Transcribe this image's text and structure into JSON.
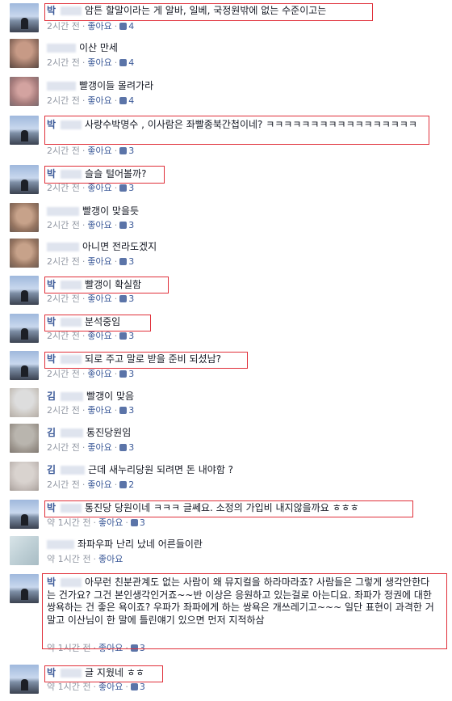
{
  "ui": {
    "like_label": "좋아요",
    "sep": "·"
  },
  "comments": [
    {
      "name": "박",
      "text": "암튼 할말이라는 게 알바, 일베, 국정원밖에 없는 수준이고는",
      "time": "2시간 전",
      "likes": "4"
    },
    {
      "name": "",
      "text": "이산 만세",
      "time": "2시간 전",
      "likes": "4"
    },
    {
      "name": "",
      "text": "빨갱이들 몰려가라",
      "time": "2시간 전",
      "likes": "4"
    },
    {
      "name": "박",
      "text": "사랑수박명수 , 이사람은 좌빨종북간첩이네? ㅋㅋㅋㅋㅋㅋㅋㅋㅋㅋㅋㅋㅋㅋㅋㅋㅋ",
      "time": "2시간 전",
      "likes": "3"
    },
    {
      "name": "박",
      "text": "슬슬 털어볼까?",
      "time": "2시간 전",
      "likes": "3"
    },
    {
      "name": "",
      "text": "빨갱이 맞을듯",
      "time": "2시간 전",
      "likes": "3"
    },
    {
      "name": "",
      "text": "아니면 전라도겠지",
      "time": "2시간 전",
      "likes": "3"
    },
    {
      "name": "박",
      "text": "빨갱이 확실함",
      "time": "2시간 전",
      "likes": "3"
    },
    {
      "name": "박",
      "text": "분석중임",
      "time": "2시간 전",
      "likes": "3"
    },
    {
      "name": "박",
      "text": "되로 주고 말로 받을 준비 되셨남?",
      "time": "2시간 전",
      "likes": "3"
    },
    {
      "name": "김",
      "text": "빨갱이 맞음",
      "time": "2시간 전",
      "likes": "3"
    },
    {
      "name": "김",
      "text": "통진당원임",
      "time": "2시간 전",
      "likes": "3"
    },
    {
      "name": "김",
      "text": "근데 새누리당원 되려면 돈 내야함 ?",
      "time": "2시간 전",
      "likes": "2"
    },
    {
      "name": "박",
      "text": "통진당 당원이네 ㅋㅋㅋ 글쎄요. 소정의 가입비 내지않을까요 ㅎㅎㅎ",
      "time": "약 1시간 전",
      "likes": "3"
    },
    {
      "name": "",
      "text": "좌파우파 난리 났네 어른들이란",
      "time": "약 1시간 전",
      "likes": ""
    },
    {
      "name": "박",
      "text": "아무런 친분관계도 없는 사람이 왜 뮤지컬을 하라마라죠? 사람들은 그렇게 생각안한다는 건가요? 그건 본인생각인거죠~~반 이상은 응원하고 있는걸로 아는디요. 좌파가 정권에 대한 쌍욕하는 건 좋은 욕이죠? 우파가 좌파에게 하는 쌍욕은 개쓰레기고~~~ 일단 표현이 과격한 거 말고 이산님이 한 말에 틀린얘기 있으면 먼저 지적하삼",
      "time": "약 1시간 전",
      "likes": "3"
    },
    {
      "name": "박",
      "text": "글 지웠네 ㅎㅎ",
      "time": "약 1시간 전",
      "likes": "3"
    }
  ]
}
